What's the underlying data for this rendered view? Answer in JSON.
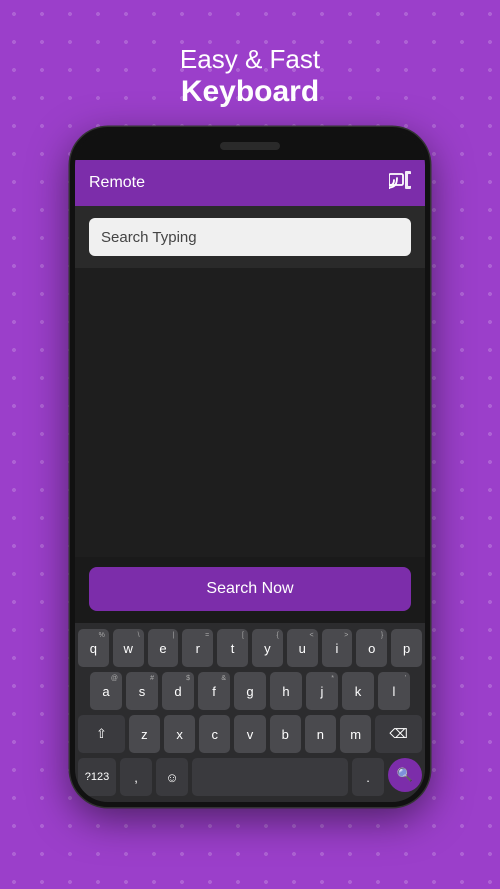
{
  "header": {
    "line1": "Easy & Fast",
    "line2": "Keyboard"
  },
  "toolbar": {
    "title": "Remote",
    "cast_icon": "⬛"
  },
  "search": {
    "placeholder": "Search Typing",
    "value": "Search Typing"
  },
  "search_button": {
    "label": "Search Now"
  },
  "keyboard": {
    "rows": [
      [
        "q",
        "w",
        "e",
        "r",
        "t",
        "y",
        "u",
        "i",
        "o",
        "p"
      ],
      [
        "a",
        "s",
        "d",
        "f",
        "g",
        "h",
        "j",
        "k",
        "l"
      ],
      [
        "z",
        "x",
        "c",
        "v",
        "b",
        "n",
        "m"
      ]
    ],
    "row_subs": [
      [
        "%",
        "\\",
        "|",
        "=",
        "[",
        "{",
        "<",
        ">",
        "}",
        ""
      ],
      [
        "@",
        "#",
        "$",
        "&",
        "",
        "",
        "*",
        "",
        ""
      ],
      [
        "",
        "",
        "",
        "",
        "",
        "",
        ""
      ]
    ],
    "bottom": {
      "num_label": "?123",
      "emoji": "☺",
      "period": "."
    }
  }
}
